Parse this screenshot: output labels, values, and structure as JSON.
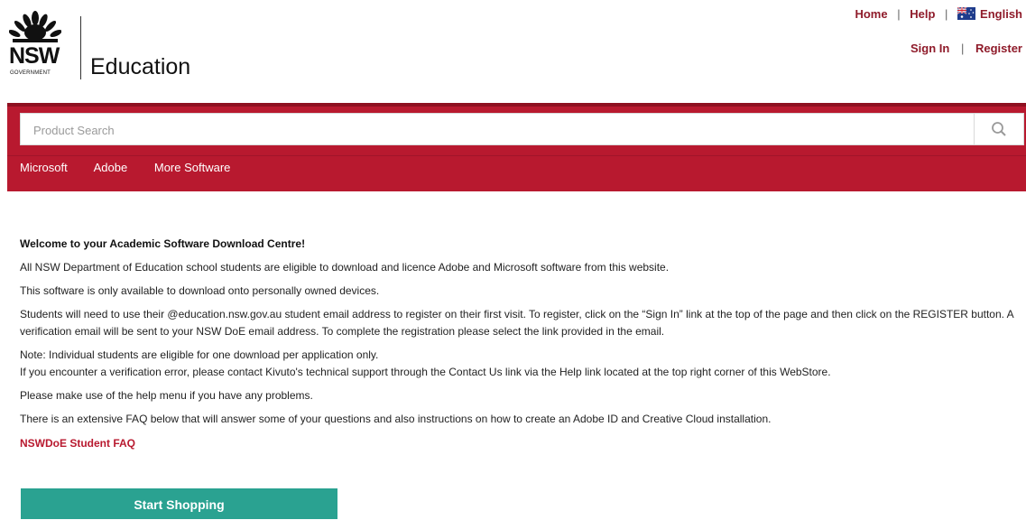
{
  "brand": {
    "logo_nsw": "NSW",
    "logo_gov": "GOVERNMENT",
    "logo_edu": "Education"
  },
  "top_links": {
    "home": "Home",
    "help": "Help",
    "language": "English",
    "sign_in": "Sign In",
    "register": "Register",
    "separator": "|"
  },
  "search": {
    "placeholder": "Product Search",
    "value": ""
  },
  "nav": {
    "items": [
      "Microsoft",
      "Adobe",
      "More Software"
    ]
  },
  "content": {
    "heading": "Welcome to your Academic Software Download Centre!",
    "p1": "All NSW Department of Education school students are eligible to download and licence Adobe and Microsoft software from this website.",
    "p2": "This software is only available to download onto personally owned devices.",
    "p3": "Students will need to use their @education.nsw.gov.au student email address to register on their first visit. To register, click on the “Sign In” link at the top of the page and then click on the REGISTER button. A verification email will be sent to your NSW DoE email address. To complete the registration please select the link provided in the email.",
    "p4a": "Note: Individual students are eligible for one download per application only.",
    "p4b": "If you encounter a verification error, please contact Kivuto's technical support through the Contact Us link via the Help link located at the top right corner of this WebStore.",
    "p5": "Please make use of the help menu if you have any problems.",
    "p6": "There is an extensive FAQ below that will answer some of your questions and also instructions on how to create an Adobe ID and Creative Cloud installation.",
    "faq_link": "NSWDoE Student FAQ",
    "start_button": "Start Shopping"
  },
  "colors": {
    "brand_red": "#b8192f",
    "link_red": "#8f1b2a",
    "button_teal": "#2aa291"
  },
  "icons": {
    "search": "search-icon",
    "flag": "australia-flag-icon",
    "logo": "waratah-logo-icon"
  }
}
